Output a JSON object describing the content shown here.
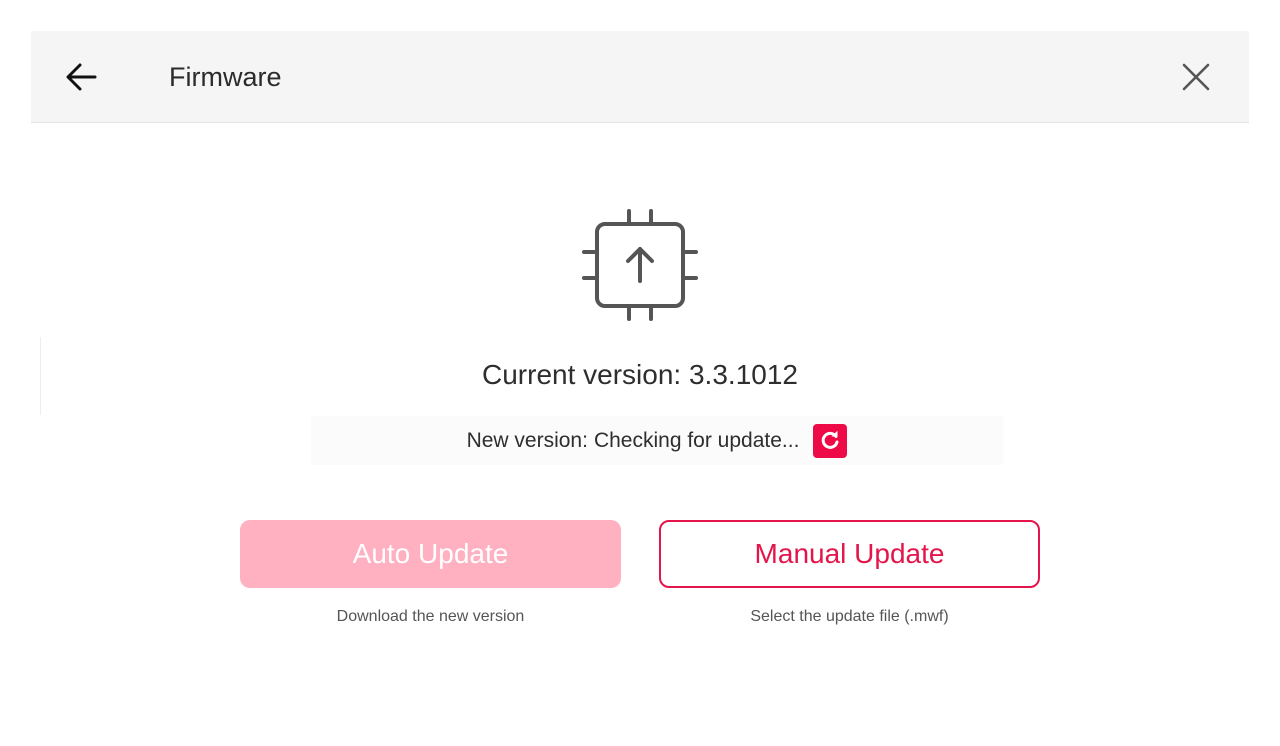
{
  "header": {
    "title": "Firmware",
    "back_icon": "arrow-left-icon",
    "close_icon": "close-icon"
  },
  "firmware": {
    "icon": "chip-upload-icon",
    "current_version_label": "Current version:",
    "current_version_value": "3.3.1012",
    "new_version_label": "New version:",
    "new_version_status": "Checking for update...",
    "refresh_icon": "refresh-icon"
  },
  "actions": {
    "auto_update": {
      "label": "Auto Update",
      "caption": "Download the new version",
      "state": "disabled"
    },
    "manual_update": {
      "label": "Manual Update",
      "caption": "Select the update file (.mwf)"
    }
  },
  "colors": {
    "accent": "#e3154a",
    "accent_disabled": "#ffb0c1",
    "refresh_bg": "#ee0a47",
    "header_bg": "#f5f5f5",
    "text": "#2e2e2e"
  }
}
